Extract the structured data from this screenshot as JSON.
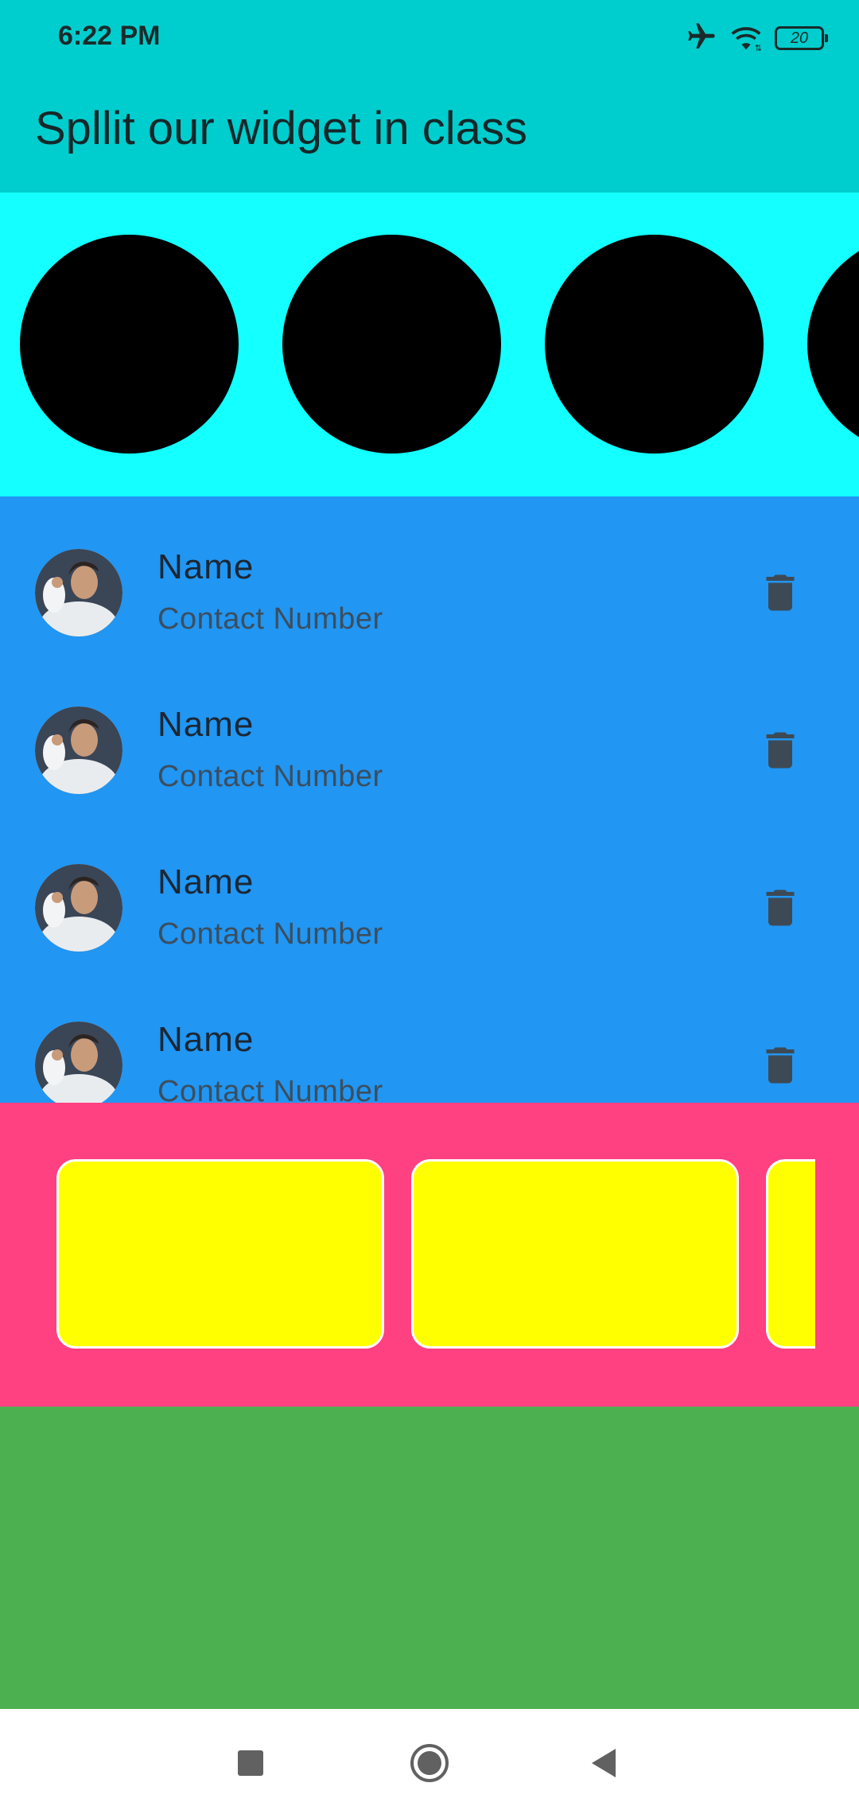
{
  "status_bar": {
    "time": "6:22 PM",
    "battery_level": "20",
    "icons": [
      "airplane-mode-icon",
      "wifi-icon",
      "battery-icon"
    ]
  },
  "app_bar": {
    "title": "Spllit our widget in class",
    "color": "#00cdcd"
  },
  "circles_section": {
    "color": "#14ffff",
    "circle_color": "#000000",
    "count_visible": 4
  },
  "contacts": {
    "color": "#2196f3",
    "items": [
      {
        "name": "Name",
        "number": "Contact Number",
        "action_icon": "delete-icon"
      },
      {
        "name": "Name",
        "number": "Contact Number",
        "action_icon": "delete-icon"
      },
      {
        "name": "Name",
        "number": "Contact Number",
        "action_icon": "delete-icon"
      },
      {
        "name": "Name",
        "number": "Contact Number",
        "action_icon": "delete-icon"
      }
    ]
  },
  "cards_section": {
    "color": "#ff4081",
    "card_color": "#ffff00",
    "count_visible": 3
  },
  "green_section": {
    "color": "#4caf50"
  },
  "nav_bar": {
    "buttons": [
      "recents-icon",
      "home-icon",
      "back-icon"
    ]
  }
}
